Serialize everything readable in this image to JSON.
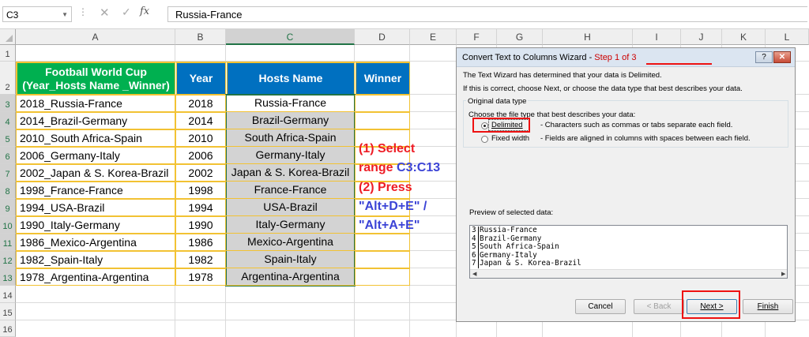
{
  "formula_bar": {
    "name_box": "C3",
    "cancel_symbol": "✕",
    "enter_symbol": "✓",
    "fx_label": "fx",
    "formula": "Russia-France"
  },
  "columns": [
    "A",
    "B",
    "C",
    "D",
    "E",
    "F",
    "G",
    "H",
    "I",
    "J",
    "K",
    "L"
  ],
  "selected_column": "C",
  "rows": [
    "1",
    "2",
    "3",
    "4",
    "5",
    "6",
    "7",
    "8",
    "9",
    "10",
    "11",
    "12",
    "13",
    "14",
    "15",
    "16"
  ],
  "selected_rows": [
    "3",
    "4",
    "5",
    "6",
    "7",
    "8",
    "9",
    "10",
    "11",
    "12",
    "13"
  ],
  "table": {
    "headers": {
      "a": "Football World Cup (Year_Hosts Name _Winner)",
      "b": "Year",
      "c": "Hosts Name",
      "d": "Winner"
    },
    "header_colors": {
      "a": "#00b050",
      "b": "#0070c0",
      "c": "#0070c0",
      "d": "#0070c0"
    },
    "rows": [
      {
        "a": "2018_Russia-France",
        "b": "2018",
        "c": "Russia-France"
      },
      {
        "a": "2014_Brazil-Germany",
        "b": "2014",
        "c": "Brazil-Germany"
      },
      {
        "a": "2010_South Africa-Spain",
        "b": "2010",
        "c": "South Africa-Spain"
      },
      {
        "a": "2006_Germany-Italy",
        "b": "2006",
        "c": "Germany-Italy"
      },
      {
        "a": "2002_Japan & S. Korea-Brazil",
        "b": "2002",
        "c": "Japan & S. Korea-Brazil"
      },
      {
        "a": "1998_France-France",
        "b": "1998",
        "c": "France-France"
      },
      {
        "a": "1994_USA-Brazil",
        "b": "1994",
        "c": "USA-Brazil"
      },
      {
        "a": "1990_Italy-Germany",
        "b": "1990",
        "c": "Italy-Germany"
      },
      {
        "a": "1986_Mexico-Argentina",
        "b": "1986",
        "c": "Mexico-Argentina"
      },
      {
        "a": "1982_Spain-Italy",
        "b": "1982",
        "c": "Spain-Italy"
      },
      {
        "a": "1978_Argentina-Argentina",
        "b": "1978",
        "c": "Argentina-Argentina"
      }
    ]
  },
  "callout": {
    "line1": "(1) Select",
    "line2a": "range ",
    "line2b": "C3:C13",
    "line3": "(2) Press",
    "line4": "\"Alt+D+E\" /",
    "line5": "\"Alt+A+E\""
  },
  "dialog": {
    "title_prefix": "Convert Text to Columns Wizard - ",
    "title_step": "Step 1 of 3",
    "help_symbol": "?",
    "close_symbol": "✕",
    "intro1": "The Text Wizard has determined that your data is Delimited.",
    "intro2": "If this is correct, choose Next, or choose the data type that best describes your data.",
    "group_label": "Original data type",
    "group_prompt": "Choose the file type that best describes your data:",
    "option_delimited": "Delimited",
    "option_delimited_desc": "- Characters such as commas or tabs separate each field.",
    "option_fixed": "Fixed width",
    "option_fixed_desc": "- Fields are aligned in columns with spaces between each field.",
    "selected_option": "Delimited",
    "preview_label": "Preview of selected data:",
    "preview_lines": [
      {
        "n": "3",
        "t": "Russia-France"
      },
      {
        "n": "4",
        "t": "Brazil-Germany"
      },
      {
        "n": "5",
        "t": "South Africa-Spain"
      },
      {
        "n": "6",
        "t": "Germany-Italy"
      },
      {
        "n": "7",
        "t": "Japan & S. Korea-Brazil"
      }
    ],
    "buttons": {
      "cancel": "Cancel",
      "back": "< Back",
      "next": "Next >",
      "finish": "Finish"
    }
  }
}
